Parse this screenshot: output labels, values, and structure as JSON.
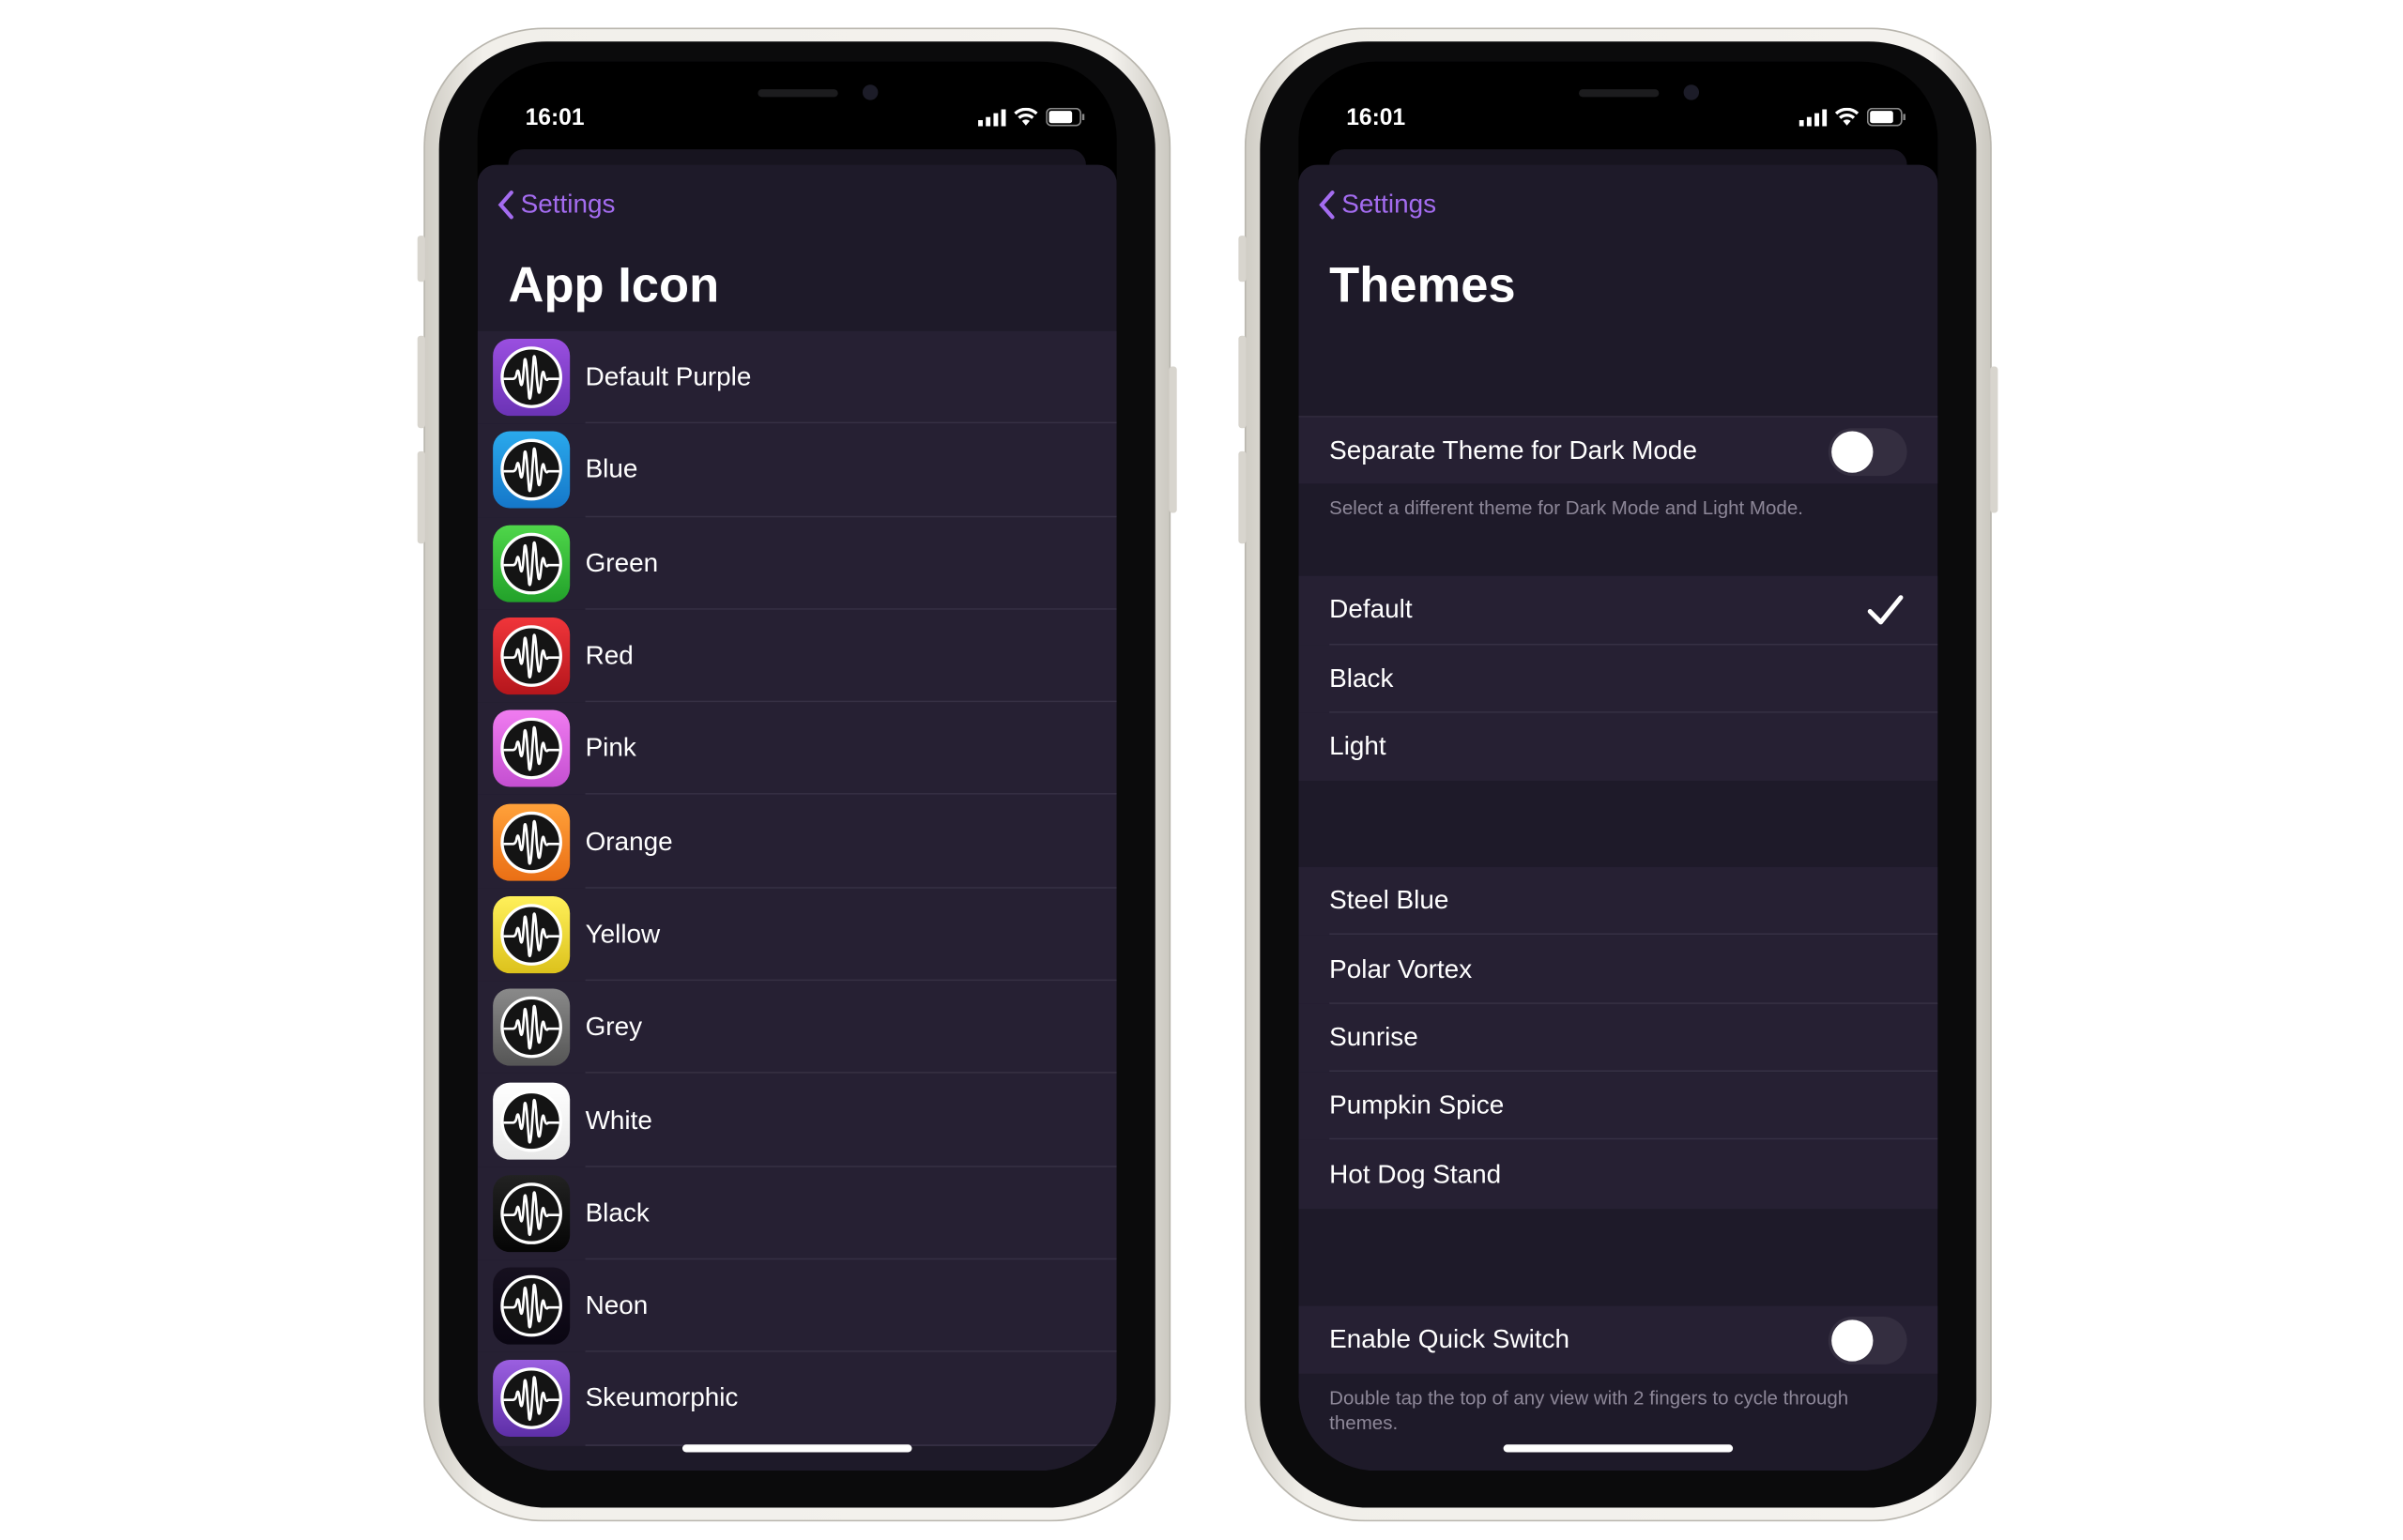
{
  "accent_color": "#a46cf0",
  "left_phone": {
    "status_time": "16:01",
    "back_label": "Settings",
    "title": "App Icon",
    "icons": [
      {
        "label": "Default Purple",
        "colors": [
          "#9a4fe0",
          "#6b33b5"
        ]
      },
      {
        "label": "Blue",
        "colors": [
          "#2aa9ec",
          "#1577c9"
        ]
      },
      {
        "label": "Green",
        "colors": [
          "#4fd64a",
          "#22a12a"
        ]
      },
      {
        "label": "Red",
        "colors": [
          "#f0353a",
          "#b5161c"
        ]
      },
      {
        "label": "Pink",
        "colors": [
          "#f07cf0",
          "#c44fd1"
        ]
      },
      {
        "label": "Orange",
        "colors": [
          "#ffa13a",
          "#ea6f15"
        ]
      },
      {
        "label": "Yellow",
        "colors": [
          "#fff05a",
          "#dcc21c"
        ]
      },
      {
        "label": "Grey",
        "colors": [
          "#8a8a8a",
          "#555"
        ]
      },
      {
        "label": "White",
        "colors": [
          "#ffffff",
          "#e8e8e8"
        ]
      },
      {
        "label": "Black",
        "colors": [
          "#222",
          "#050505"
        ]
      },
      {
        "label": "Neon",
        "colors": [
          "#16101f",
          "#0a0612"
        ]
      },
      {
        "label": "Skeumorphic",
        "colors": [
          "#9b5fe0",
          "#5e2fa8"
        ]
      }
    ]
  },
  "right_phone": {
    "status_time": "16:01",
    "back_label": "Settings",
    "title": "Themes",
    "separate_theme": {
      "label": "Separate Theme for Dark Mode",
      "on": false,
      "footer": "Select a different theme for Dark Mode and Light Mode."
    },
    "basic_themes": [
      {
        "label": "Default",
        "selected": true
      },
      {
        "label": "Black"
      },
      {
        "label": "Light"
      }
    ],
    "extra_themes": [
      "Steel Blue",
      "Polar Vortex",
      "Sunrise",
      "Pumpkin Spice",
      "Hot Dog Stand"
    ],
    "quick_switch": {
      "label": "Enable Quick Switch",
      "on": false,
      "footer": "Double tap the top of any view with 2 fingers to cycle through themes."
    }
  }
}
